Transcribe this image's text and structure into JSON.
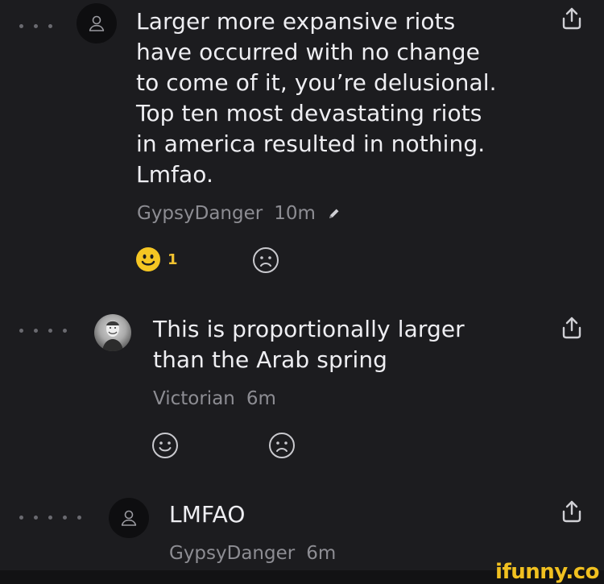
{
  "comments": [
    {
      "text": "Larger more expansive riots\nhave occurred with no change\nto come of it, you’re delusional.\nTop ten most devastating riots\nin america resulted in nothing.\nLmfao.",
      "author": "GypsyDanger",
      "time": "10m",
      "edited_icon": "pencil-icon",
      "reactions": {
        "happy_count": "1"
      }
    },
    {
      "text": "This is proportionally larger\nthan the Arab spring",
      "author": "Victorian",
      "time": "6m"
    },
    {
      "text": "LMFAO",
      "author": "GypsyDanger",
      "time": "6m"
    }
  ],
  "watermark": "ifunny.co",
  "colors": {
    "background": "#1c1c1f",
    "text": "#eeeef2",
    "meta": "#8d8d93",
    "accent": "#f2c230"
  }
}
